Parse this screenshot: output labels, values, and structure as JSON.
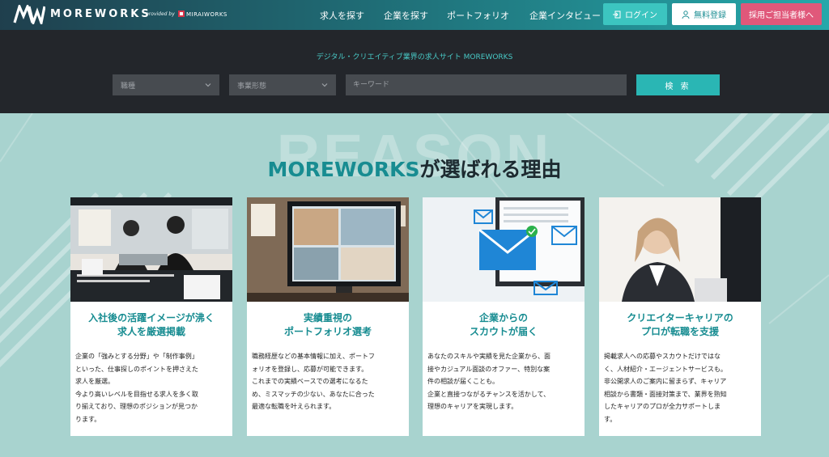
{
  "header": {
    "brand": "MOREWORKS",
    "provided_by": "provided by",
    "company": "MIRAIWORKS",
    "nav": [
      "求人を探す",
      "企業を探す",
      "ポートフォリオ",
      "企業インタビュー"
    ],
    "login": "ログイン",
    "register": "無料登録",
    "employer": "採用ご担当者様へ"
  },
  "search": {
    "tagline": "デジタル・クリエイティブ業界の求人サイト MOREWORKS",
    "job_placeholder": "職種",
    "type_placeholder": "事業形態",
    "keyword_placeholder": "キーワード",
    "button": "検 索"
  },
  "reason": {
    "bg_word": "REASON",
    "title_accent": "MOREWORKS",
    "title_rest": "が選ばれる理由"
  },
  "cards": [
    {
      "title1": "入社後の活躍イメージが沸く",
      "title2": "求人を厳選掲載",
      "body": [
        "企業の「強みとする分野」や「制作事例」",
        "といった、仕事探しのポイントを押さえた",
        "求人を厳選。",
        "今より高いレベルを目指せる求人を多く取",
        "り揃えており、理想のポジションが見つか",
        "ります。"
      ]
    },
    {
      "title1": "実績重視の",
      "title2": "ポートフォリオ選考",
      "body": [
        "職務経歴などの基本情報に加え、ポートフ",
        "ォリオを登録し、応募が可能できます。",
        "これまでの実績ベースでの選考になるた",
        "め、ミスマッチの少ない、あなたに合った",
        "最適な転職を叶えられます。"
      ]
    },
    {
      "title1": "企業からの",
      "title2": "スカウトが届く",
      "body": [
        "あなたのスキルや実績を見た企業から、面",
        "接やカジュアル面談のオファー、特別な案",
        "件の相談が届くことも。",
        "企業と直接つながるチャンスを活かして、",
        "理想のキャリアを実現します。"
      ]
    },
    {
      "title1": "クリエイターキャリアの",
      "title2": "プロが転職を支援",
      "body": [
        "掲載求人への応募やスカウトだけではな",
        "く、人材紹介・エージェントサービスも。",
        "非公開求人のご案内に留まらず、キャリア",
        "相談から書類・面接対策まで、業界を熟知",
        "したキャリアのプロが全力サポートしま",
        "す。"
      ]
    }
  ],
  "colors": {
    "accent": "#178c91",
    "header_start": "#1f3f4d",
    "header_end": "#26a8aa",
    "background": "#a8d3cf",
    "employer_button": "#e0587a"
  }
}
